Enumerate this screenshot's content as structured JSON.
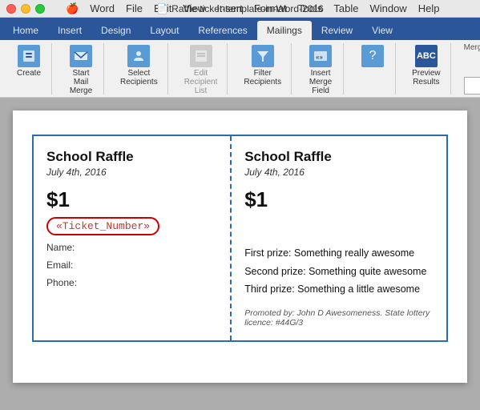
{
  "titlebar": {
    "title": "Raffle-ticket-template-in-Word-2016",
    "file_icon": "📄"
  },
  "menu": {
    "items": [
      "Apple",
      "Word",
      "File",
      "Edit",
      "View",
      "Insert",
      "Format",
      "Tools",
      "Table",
      "Window",
      "Help"
    ]
  },
  "ribbon": {
    "tabs": [
      "Home",
      "Insert",
      "Design",
      "Layout",
      "References",
      "Mailings",
      "Review",
      "View"
    ],
    "active_tab": "Mailings",
    "groups": [
      {
        "buttons": [
          {
            "label": "Create",
            "icon": "📋"
          }
        ]
      },
      {
        "buttons": [
          {
            "label": "Start Mail\nMerge",
            "icon": "✉️"
          }
        ]
      },
      {
        "buttons": [
          {
            "label": "Select\nRecipients",
            "icon": "👥"
          }
        ]
      },
      {
        "buttons": [
          {
            "label": "Edit\nRecipient List",
            "icon": "✏️"
          }
        ]
      },
      {
        "buttons": [
          {
            "label": "Filter\nRecipients",
            "icon": "🔽"
          }
        ]
      },
      {
        "buttons": [
          {
            "label": "Insert\nMerge Field",
            "icon": "⬛"
          }
        ]
      },
      {
        "buttons": [
          {
            "label": "?",
            "icon": "❓"
          }
        ]
      },
      {
        "buttons": [
          {
            "label": "ABC",
            "icon": "🔤"
          }
        ]
      },
      {
        "buttons": [
          {
            "label": "Preview\nResults",
            "icon": "👁️"
          }
        ]
      }
    ],
    "merge_range_label": "Merge Range",
    "merge_range_value": ""
  },
  "document": {
    "tickets": [
      {
        "left": {
          "title": "School Raffle",
          "date": "July 4th, 2016",
          "price": "$1",
          "ticket_number_field": "«Ticket_Number»",
          "fields": [
            {
              "label": "Name:"
            },
            {
              "label": "Email:"
            },
            {
              "label": "Phone:"
            }
          ]
        },
        "right": {
          "title": "School Raffle",
          "date": "July 4th, 2016",
          "price": "$1",
          "prizes": [
            "First prize: Something really awesome",
            "Second prize: Something quite awesome",
            "Third prize: Something a little awesome"
          ],
          "promo": "Promoted by: John D Awesomeness. State lottery licence: #44G/3"
        }
      }
    ]
  }
}
